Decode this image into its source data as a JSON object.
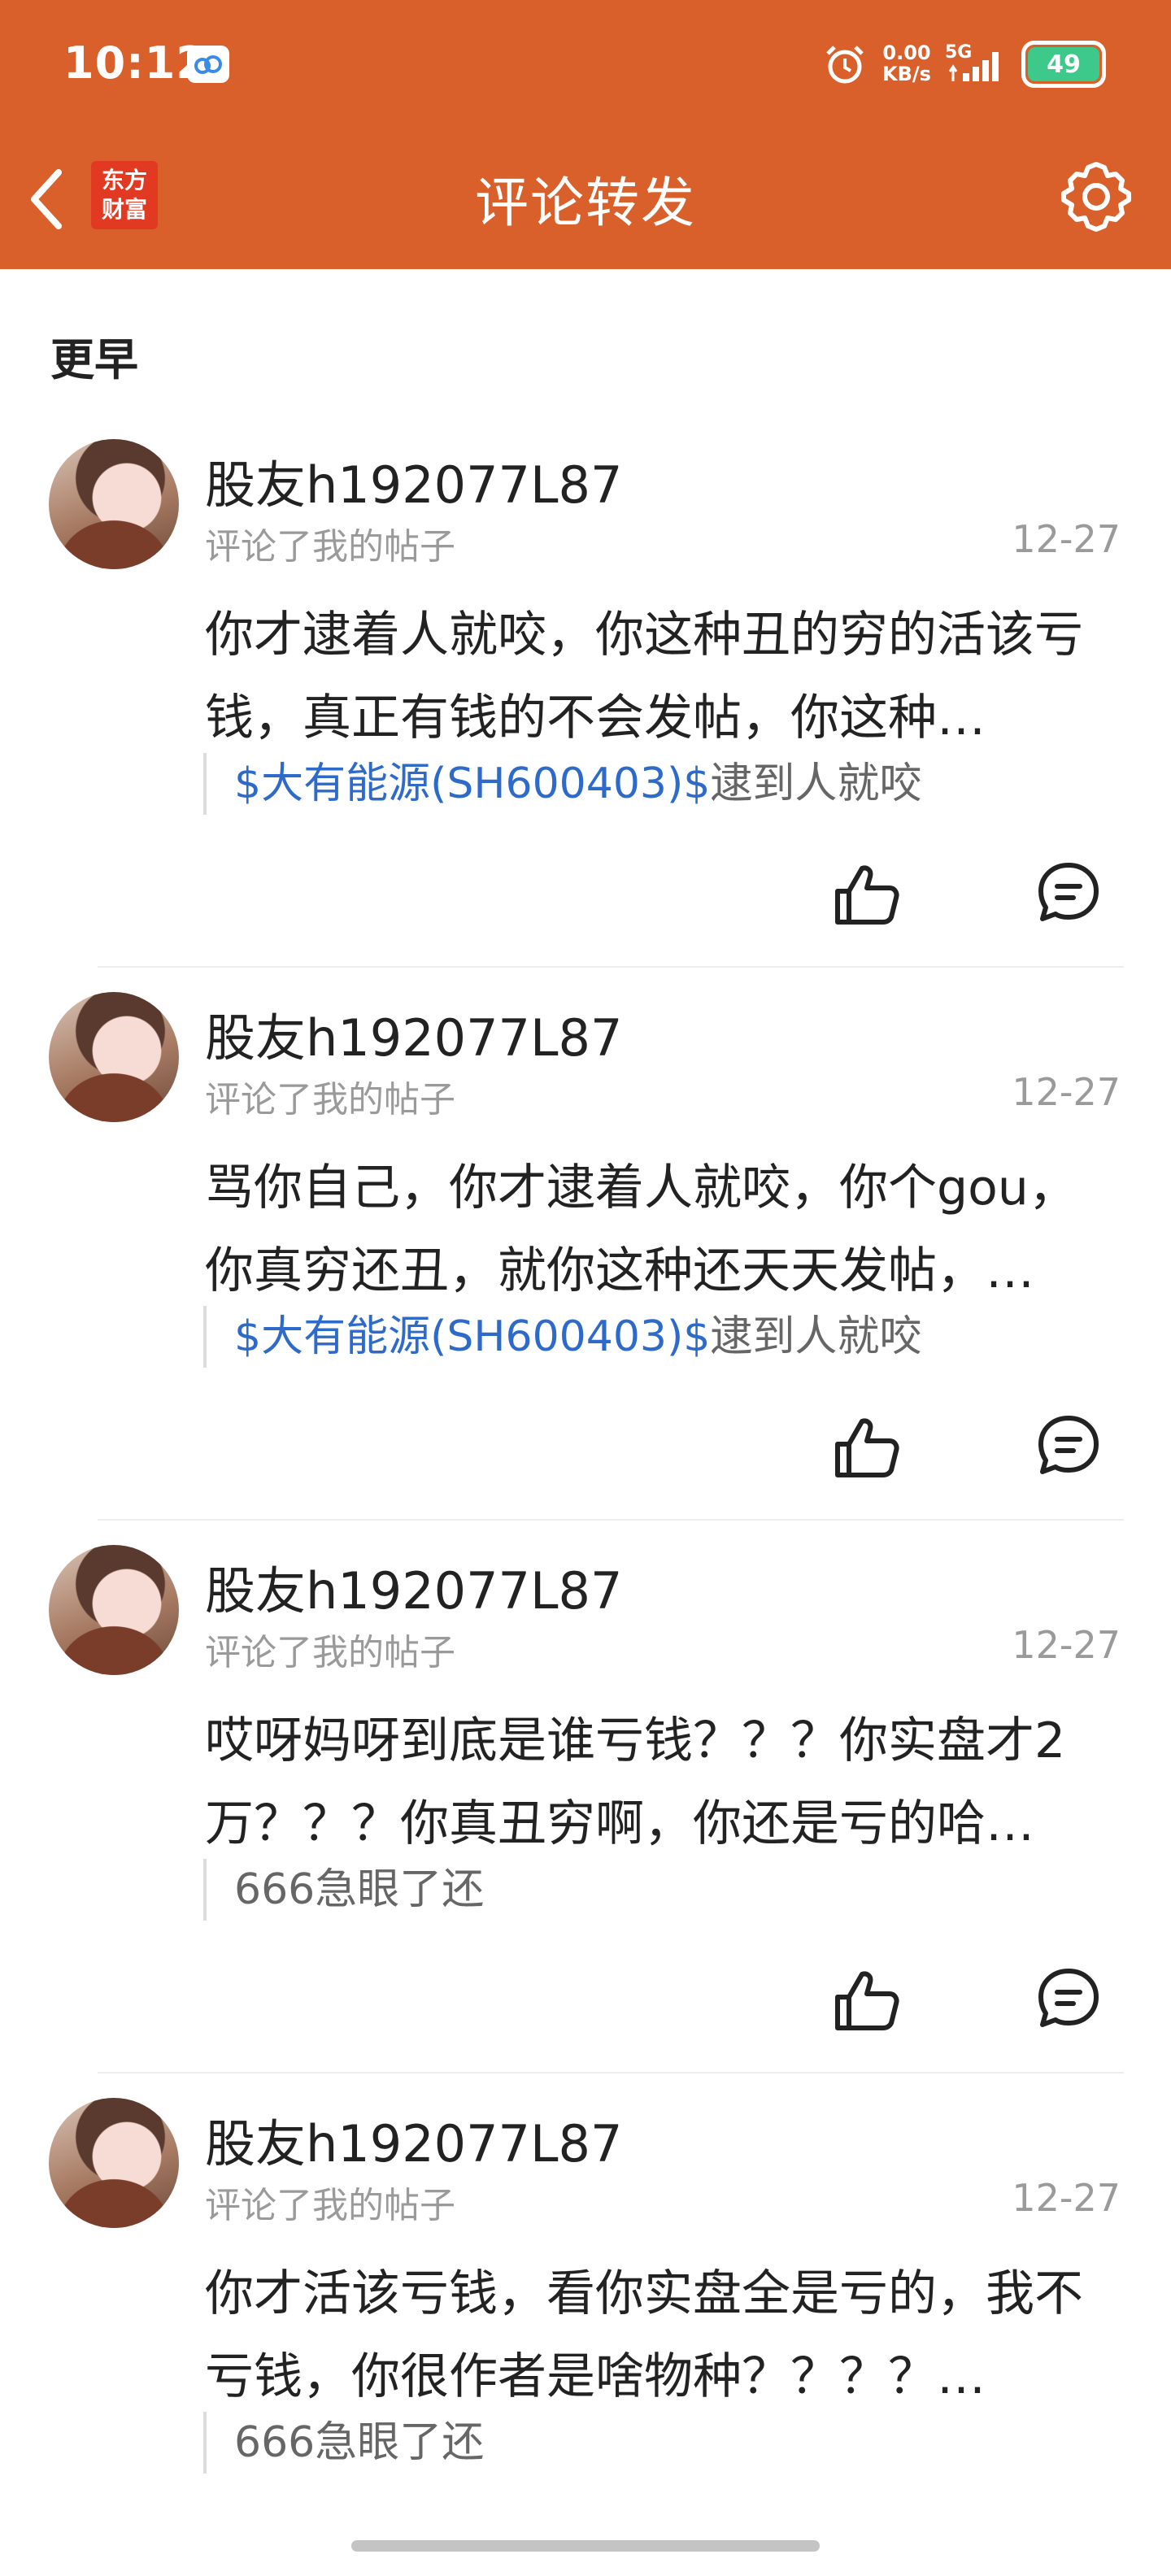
{
  "status_bar": {
    "time": "10:12",
    "net_speed_value": "0.00",
    "net_speed_unit": "KB/s",
    "network": "5G",
    "battery": "49"
  },
  "header": {
    "title": "评论转发",
    "logo_line1": "东方",
    "logo_line2": "财富"
  },
  "section_label": "更早",
  "colors": {
    "header_bg": "#D9602A",
    "stock_link": "#2E6AC9"
  },
  "items": [
    {
      "username": "股友h192077L87",
      "action": "评论了我的帖子",
      "date": "12-27",
      "content": "你才逮着人就咬，你这种丑的穷的活该亏钱，真正有钱的不会发帖，你这种…",
      "quote_stock": "$大有能源(SH600403)$",
      "quote_text": "逮到人就咬"
    },
    {
      "username": "股友h192077L87",
      "action": "评论了我的帖子",
      "date": "12-27",
      "content": "骂你自己，你才逮着人就咬，你个gou，你真穷还丑，就你这种还天天发帖，…",
      "quote_stock": "$大有能源(SH600403)$",
      "quote_text": "逮到人就咬"
    },
    {
      "username": "股友h192077L87",
      "action": "评论了我的帖子",
      "date": "12-27",
      "content": "哎呀妈呀到底是谁亏钱？？？你实盘才2万？？？你真丑穷啊，你还是亏的哈…",
      "quote_stock": "",
      "quote_text": "666急眼了还"
    },
    {
      "username": "股友h192077L87",
      "action": "评论了我的帖子",
      "date": "12-27",
      "content": "你才活该亏钱，看你实盘全是亏的，我不亏钱，你很作者是啥物种？？？？…",
      "quote_stock": "",
      "quote_text": "666急眼了还"
    }
  ]
}
